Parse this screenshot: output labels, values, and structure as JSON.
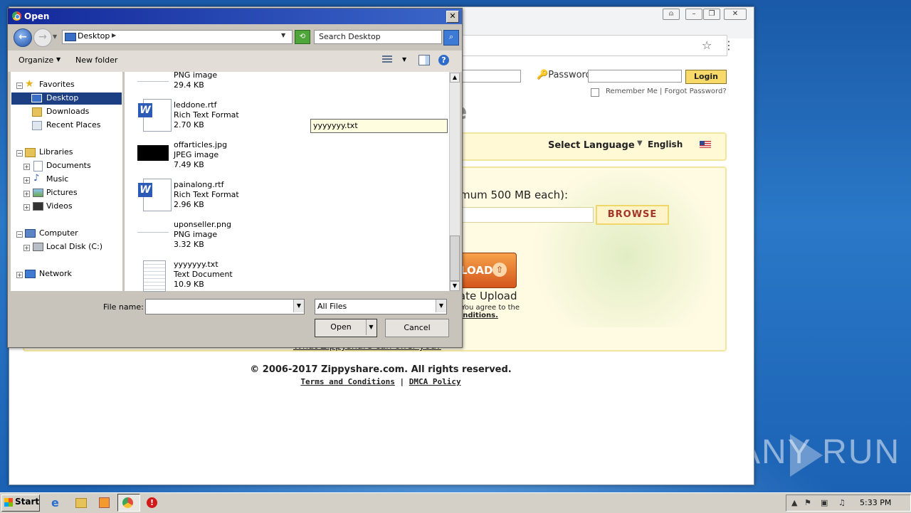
{
  "browser": {
    "window_controls": [
      "⍝",
      "–",
      "❐",
      "✕"
    ],
    "login": {
      "password_label": "Password:",
      "login_button": "Login",
      "remember_me": "Remember Me",
      "separator": "|",
      "forgot_password": "Forgot Password?"
    },
    "logo_fragment": "e",
    "language": {
      "label": "Select Language:",
      "value": "English",
      "caret": "▼"
    },
    "upload": {
      "max_size_text": "timum 500 MB each):",
      "browse_button": "BROWSE",
      "upload_button": "PLOAD",
      "private_upload": "vate Upload",
      "agree_text": "le You agree to the",
      "conditions_text": "Conditions.",
      "offer_link": "What Zippyshare can offer you?"
    },
    "footer": {
      "copyright": "© 2006-2017 Zippyshare.com. All rights reserved.",
      "terms": "Terms and Conditions",
      "separator": "|",
      "dmca": "DMCA Policy"
    }
  },
  "dialog": {
    "title": "Open",
    "close": "✕",
    "address": "Desktop",
    "search_placeholder": "Search Desktop",
    "toolbar": {
      "organize": "Organize",
      "new_folder": "New folder"
    },
    "nav": {
      "favorites": "Favorites",
      "desktop": "Desktop",
      "downloads": "Downloads",
      "recent_places": "Recent Places",
      "libraries": "Libraries",
      "documents": "Documents",
      "music": "Music",
      "pictures": "Pictures",
      "videos": "Videos",
      "computer": "Computer",
      "local_disk": "Local Disk (C:)",
      "network": "Network"
    },
    "files": [
      {
        "name": "",
        "type": "PNG image",
        "size": "29.4 KB"
      },
      {
        "name": "leddone.rtf",
        "type": "Rich Text Format",
        "size": "2.70 KB"
      },
      {
        "name": "offarticles.jpg",
        "type": "JPEG image",
        "size": "7.49 KB"
      },
      {
        "name": "painalong.rtf",
        "type": "Rich Text Format",
        "size": "2.96 KB"
      },
      {
        "name": "uponseller.png",
        "type": "PNG image",
        "size": "3.32 KB"
      },
      {
        "name": "yyyyyyy.txt",
        "type": "Text Document",
        "size": "10.9 KB"
      }
    ],
    "rename_value": "yyyyyyy.txt",
    "file_name_label": "File name:",
    "file_name_value": "",
    "file_type": "All Files",
    "open_button": "Open",
    "cancel_button": "Cancel"
  },
  "taskbar": {
    "start": "Start",
    "clock": "5:33 PM"
  },
  "watermark": "ANY RUN"
}
